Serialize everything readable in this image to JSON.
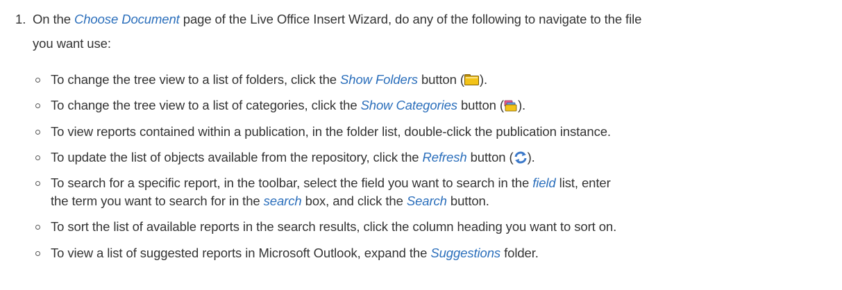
{
  "step": {
    "number": "1.",
    "intro_a": "On the ",
    "intro_link": "Choose Document",
    "intro_b": " page of the Live Office Insert Wizard, do any of the following to navigate to the file",
    "intro_c": "you want use:"
  },
  "items": [
    {
      "a": "To change the tree view to a list of folders, click the ",
      "link": "Show Folders",
      "b": " button (",
      "icon": "folder-icon",
      "c": ")."
    },
    {
      "a": "To change the tree view to a list of categories, click the ",
      "link": "Show Categories",
      "b": " button (",
      "icon": "categories-icon",
      "c": ")."
    },
    {
      "a": "To view reports contained within a publication, in the folder list, double-click the publication instance."
    },
    {
      "a": "To update the list of objects available from the repository, click the ",
      "link": "Refresh",
      "b": " button (",
      "icon": "refresh-icon",
      "c": ")."
    },
    {
      "a": "To search for a specific report, in the toolbar, select the field you want to search in the ",
      "link": "field",
      "b": " list, enter",
      "a2": "the term you want to search for in the ",
      "link2": "search",
      "b2": " box, and click the ",
      "link3": "Search",
      "c2": " button."
    },
    {
      "a": "To sort the list of available reports in the search results, click the column heading you want to sort on."
    },
    {
      "a": "To view a list of suggested reports in Microsoft Outlook, expand the ",
      "link": "Suggestions",
      "b": " folder."
    }
  ],
  "colors": {
    "text": "#333333",
    "link": "#2a6ebb",
    "folder_icon": "#f3c318",
    "refresh_icon": "#3a78c9"
  }
}
